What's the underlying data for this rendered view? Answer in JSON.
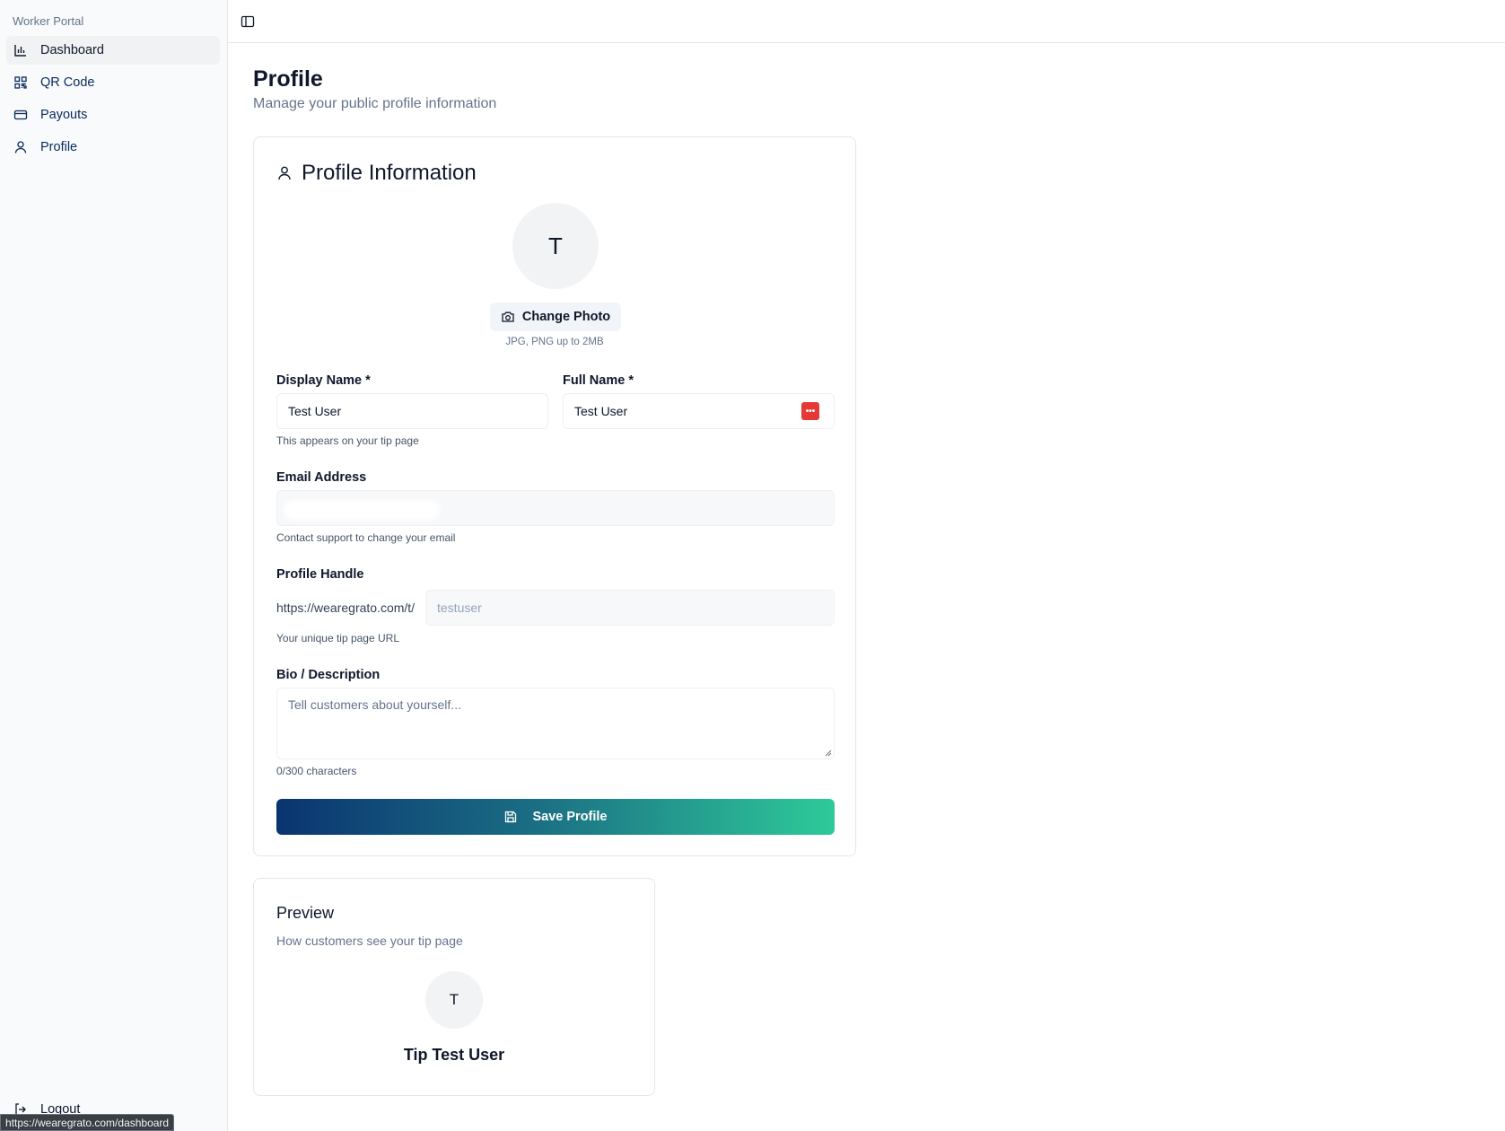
{
  "sidebar": {
    "title": "Worker Portal",
    "items": [
      {
        "label": "Dashboard",
        "icon": "bar-chart-icon"
      },
      {
        "label": "QR Code",
        "icon": "qr-code-icon"
      },
      {
        "label": "Payouts",
        "icon": "credit-card-icon"
      },
      {
        "label": "Profile",
        "icon": "user-icon"
      }
    ],
    "logout_label": "Logout"
  },
  "status_bar": {
    "url": "https://wearegrato.com/dashboard"
  },
  "page": {
    "title": "Profile",
    "subtitle": "Manage your public profile information"
  },
  "profile_card": {
    "title": "Profile Information",
    "avatar_initial": "T",
    "change_photo_label": "Change Photo",
    "photo_hint": "JPG, PNG up to 2MB",
    "display_name": {
      "label": "Display Name *",
      "value": "Test User",
      "hint": "This appears on your tip page"
    },
    "full_name": {
      "label": "Full Name *",
      "value": "Test User"
    },
    "email": {
      "label": "Email Address",
      "value": "",
      "hint": "Contact support to change your email"
    },
    "handle": {
      "label": "Profile Handle",
      "prefix": "https://wearegrato.com/t/",
      "value": "testuser",
      "hint": "Your unique tip page URL"
    },
    "bio": {
      "label": "Bio / Description",
      "placeholder": "Tell customers about yourself...",
      "counter": "0/300 characters"
    },
    "save_label": "Save Profile"
  },
  "preview": {
    "title": "Preview",
    "subtitle": "How customers see your tip page",
    "avatar_initial": "T",
    "name": "Tip Test User"
  },
  "colors": {
    "nav_text": "#0b2a5b",
    "gradient_start": "#0a3470",
    "gradient_end": "#2eca99",
    "password_manager_icon": "#e53935"
  }
}
